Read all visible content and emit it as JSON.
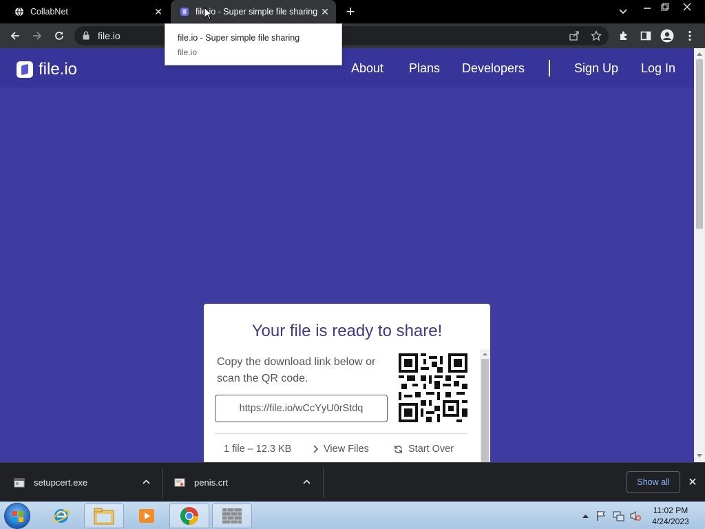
{
  "tabs": [
    {
      "title": "CollabNet",
      "favicon": "globe-icon",
      "active": false
    },
    {
      "title": "file.io - Super simple file sharing",
      "favicon": "fileio-icon",
      "active": true
    }
  ],
  "tooltip": {
    "title": "file.io - Super simple file sharing",
    "domain": "file.io"
  },
  "address": {
    "url": "file.io"
  },
  "site": {
    "brand": "file.io",
    "nav": [
      "About",
      "Plans",
      "Developers"
    ],
    "auth": [
      "Sign Up",
      "Log In"
    ]
  },
  "card": {
    "headline": "Your file is ready to share!",
    "description": "Copy the download link below or scan the QR code.",
    "link": "https://file.io/wCcYyU0rStdq",
    "file_info": "1 file – 12.3 KB",
    "view_files": "View Files",
    "start_over": "Start Over"
  },
  "downloads": [
    {
      "name": "setupcert.exe",
      "icon": "exe-file-icon"
    },
    {
      "name": "penis.crt",
      "icon": "certificate-file-icon"
    }
  ],
  "shelf": {
    "show_all": "Show all"
  },
  "taskbar": {
    "time": "11:02 PM",
    "date": "4/24/2023"
  },
  "colors": {
    "brand_bg": "#3f3ca1",
    "brand_nav": "#38359a",
    "headline": "#3d3a8c"
  }
}
